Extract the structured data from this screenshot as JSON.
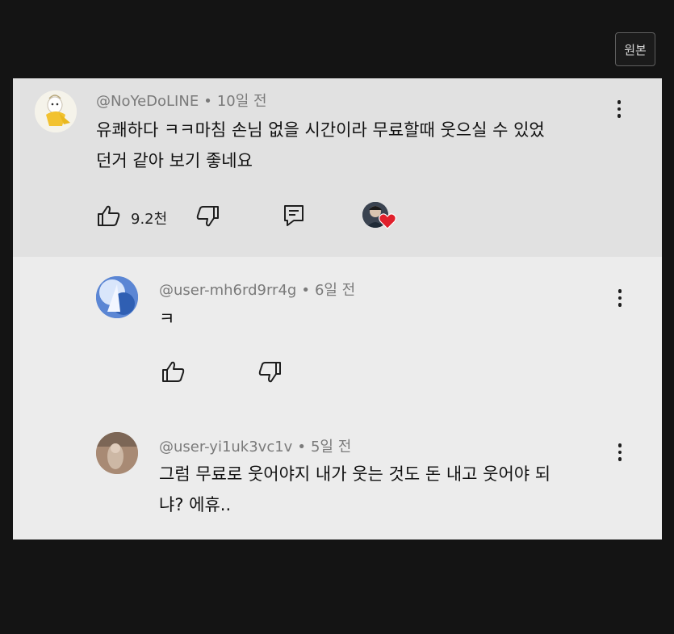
{
  "header": {
    "original_button": "원본"
  },
  "comment": {
    "handle": "@NoYeDoLINE",
    "separator": "•",
    "time": "10일 전",
    "text_line1": "유쾌하다 ㅋㅋ마침 손님 없을 시간이라 무료할때 웃으실 수 있었",
    "text_line2": "던거 같아 보기 좋네요",
    "like_count": "9.2천",
    "icons": [
      "like-icon",
      "dislike-icon",
      "reply-icon",
      "creator-heart-icon",
      "more-vert-icon"
    ]
  },
  "replies": [
    {
      "handle": "@user-mh6rd9rr4g",
      "separator": "•",
      "time": "6일 전",
      "text_line1": "ㅋ",
      "text_line2": ""
    },
    {
      "handle": "@user-yi1uk3vc1v",
      "separator": "•",
      "time": "5일 전",
      "text_line1": "그럼 무료로 웃어야지 내가 웃는 것도 돈 내고 웃어야 되",
      "text_line2": "냐? 에휴.."
    }
  ],
  "colors": {
    "page_bg": "#141414",
    "panel_bg": "#ececec",
    "top_comment_bg": "#e1e1e1",
    "heart": "#e0202c"
  }
}
